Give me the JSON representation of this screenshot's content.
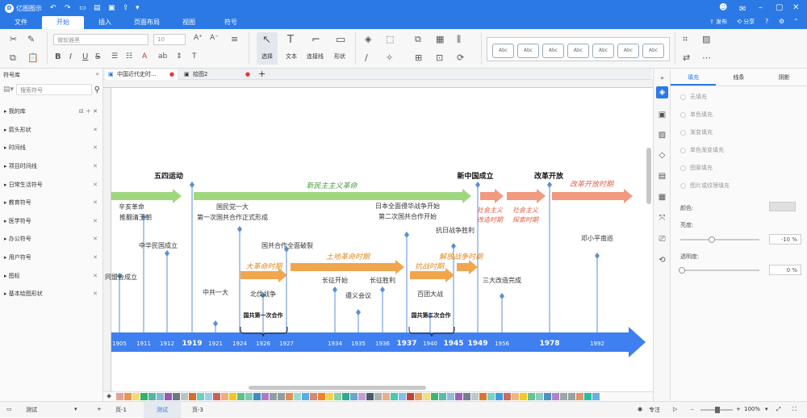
{
  "app": {
    "name": "亿图图示"
  },
  "menu": [
    "文件",
    "开始",
    "插入",
    "页面布局",
    "视图",
    "符号"
  ],
  "user": {
    "publish": "发布",
    "share": "分享"
  },
  "ribbon": {
    "font_name": "微软雅黑",
    "font_size": "10",
    "tools": [
      "选择",
      "文本",
      "连接线",
      "形状"
    ],
    "style_boxes": [
      "Abc",
      "Abc",
      "Abc",
      "Abc",
      "Abc",
      "Abc",
      "Abc"
    ]
  },
  "left_panel": {
    "title": "符号库",
    "search_placeholder": "搜索符号",
    "libraries": [
      "我的库",
      "箭头形状",
      "时间线",
      "项目时间线",
      "日常生活符号",
      "教育符号",
      "医学符号",
      "办公符号",
      "用户符号",
      "图标",
      "基本绘图形状"
    ]
  },
  "doc_tabs": [
    "中国近代史时...",
    "绘图2"
  ],
  "right_panel": {
    "tabs": [
      "填充",
      "线条",
      "阴影"
    ],
    "fill_options": [
      "无填充",
      "单色填充",
      "渐变填充",
      "单色渐变填充",
      "图案填充",
      "图片或纹理填充"
    ],
    "color_label": "颜色:",
    "brightness_label": "亮度:",
    "brightness_value": "-10 %",
    "transparency_label": "透明度:",
    "transparency_value": "0 %"
  },
  "status": {
    "page_select": "测试",
    "pages": [
      "页-1",
      "测试",
      "页-3"
    ],
    "focus": "专注",
    "zoom": "100%"
  },
  "colors": {
    "accent": "#2b79e5",
    "green": "#9fd77e",
    "orange": "#f0a64d",
    "salmon": "#f19a7f",
    "axis": "#3f7ff0"
  },
  "timeline": {
    "years": [
      "1905",
      "1911",
      "1912",
      "1919",
      "1921",
      "1924",
      "1926",
      "1927",
      "1934",
      "1935",
      "1936",
      "1937",
      "1940",
      "1945",
      "1949",
      "1956",
      "1978",
      "1992"
    ],
    "major_years": [
      "1919",
      "1937",
      "1945",
      "1949",
      "1978"
    ],
    "headings": [
      "五四运动",
      "新中国成立",
      "改革开放"
    ],
    "eras": [
      "新民主主义革命",
      "社会主义改造时期",
      "社会主义探索时期",
      "改革开放时期"
    ],
    "periods": [
      "大革命时期",
      "土地革命时期",
      "抗战时期",
      "解放战争时期"
    ],
    "brackets": [
      "国共第一次合作",
      "国共第二次合作"
    ],
    "events": [
      "辛亥革命推翻清王朝",
      "中华民国成立",
      "同盟会成立",
      "中共一大",
      "国民党一大第一次国共合作正式形成",
      "北伐战争",
      "国共合作全面破裂",
      "长征开始",
      "遵义会议",
      "长征胜利",
      "日本全面侵华战争开始第二次国共合作开始",
      "百团大战",
      "抗日战争胜利",
      "三大改造完成",
      "邓小平南巡"
    ]
  }
}
